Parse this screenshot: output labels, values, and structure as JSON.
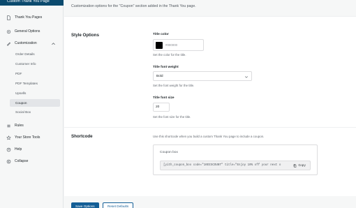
{
  "app": {
    "title": "Custom Thank You Page"
  },
  "sidebar": {
    "items": [
      {
        "label": "Thank You Pages",
        "icon": "file-icon"
      },
      {
        "label": "General Options",
        "icon": "gear-icon"
      },
      {
        "label": "Customization",
        "icon": "brush-icon"
      },
      {
        "label": "Rules",
        "icon": "list-icon"
      },
      {
        "label": "Your Store Tools",
        "icon": "star-icon"
      },
      {
        "label": "Help",
        "icon": "help-icon"
      },
      {
        "label": "Collapse",
        "icon": "collapse-icon"
      }
    ],
    "subitems": [
      {
        "label": "Order Details"
      },
      {
        "label": "Customer Info"
      },
      {
        "label": "PDF"
      },
      {
        "label": "PDF Templates"
      },
      {
        "label": "Upsells"
      },
      {
        "label": "Coupon"
      },
      {
        "label": "Social Box"
      }
    ]
  },
  "main": {
    "intro": "Customization options for the \"Coupon\" section added in the Thank You page."
  },
  "style_options": {
    "title": "Style Options",
    "title_color": {
      "label": "Title color",
      "value": "#000000",
      "help": "Set the color for the title."
    },
    "title_font_weight": {
      "label": "Title font weight",
      "value": "Bold",
      "help": "Set the font weight for the title."
    },
    "title_font_size": {
      "label": "Title font size",
      "value": "20",
      "help": "Set the font size for the title."
    }
  },
  "shortcode": {
    "title": "Shortcode",
    "help": "Use this shortcode when you build a custom Thank You page to include a coupon.",
    "box_title": "Coupon box",
    "code": "[yith_coupon_box code=\"10DISCOUNT\" title=\"Enjoy 10% off your next o",
    "copy_label": "Copy"
  },
  "footer": {
    "save_label": "Save Options",
    "reset_label": "Reset Defaults"
  },
  "colors": {
    "brand": "#0b4a6e",
    "primary": "#135e96"
  }
}
